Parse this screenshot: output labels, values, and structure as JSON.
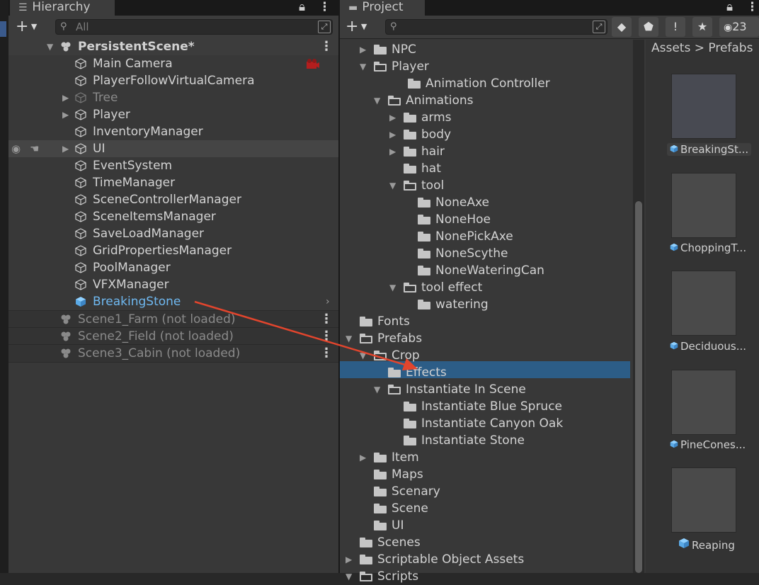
{
  "hierarchy": {
    "tab_title": "Hierarchy",
    "search_placeholder": "All",
    "scene_name": "PersistentScene*",
    "items": [
      {
        "label": "Main Camera"
      },
      {
        "label": "PlayerFollowVirtualCamera"
      },
      {
        "label": "Tree"
      },
      {
        "label": "Player"
      },
      {
        "label": "InventoryManager"
      },
      {
        "label": "UI"
      },
      {
        "label": "EventSystem"
      },
      {
        "label": "TimeManager"
      },
      {
        "label": "SceneControllerManager"
      },
      {
        "label": "SceneItemsManager"
      },
      {
        "label": "SaveLoadManager"
      },
      {
        "label": "GridPropertiesManager"
      },
      {
        "label": "PoolManager"
      },
      {
        "label": "VFXManager"
      },
      {
        "label": "BreakingStone"
      }
    ],
    "unloaded_scenes": [
      {
        "label": "Scene1_Farm (not loaded)"
      },
      {
        "label": "Scene2_Field (not loaded)"
      },
      {
        "label": "Scene3_Cabin (not loaded)"
      }
    ]
  },
  "project": {
    "tab_title": "Project",
    "hidden_count": "23",
    "breadcrumb": "Assets > Prefabs",
    "tree": [
      {
        "label": "NPC"
      },
      {
        "label": "Player"
      },
      {
        "label": "Animation Controller"
      },
      {
        "label": "Animations"
      },
      {
        "label": "arms"
      },
      {
        "label": "body"
      },
      {
        "label": "hair"
      },
      {
        "label": "hat"
      },
      {
        "label": "tool"
      },
      {
        "label": "NoneAxe"
      },
      {
        "label": "NoneHoe"
      },
      {
        "label": "NonePickAxe"
      },
      {
        "label": "NoneScythe"
      },
      {
        "label": "NoneWateringCan"
      },
      {
        "label": "tool effect"
      },
      {
        "label": "watering"
      },
      {
        "label": "Fonts"
      },
      {
        "label": "Prefabs"
      },
      {
        "label": "Crop"
      },
      {
        "label": "Effects"
      },
      {
        "label": "Instantiate In Scene"
      },
      {
        "label": "Instantiate Blue Spruce"
      },
      {
        "label": "Instantiate Canyon Oak"
      },
      {
        "label": "Instantiate Stone"
      },
      {
        "label": "Item"
      },
      {
        "label": "Maps"
      },
      {
        "label": "Scenary"
      },
      {
        "label": "Scene"
      },
      {
        "label": "UI"
      },
      {
        "label": "Scenes"
      },
      {
        "label": "Scriptable Object Assets"
      },
      {
        "label": "Scripts"
      }
    ],
    "assets": [
      {
        "label": "BreakingSt..."
      },
      {
        "label": "ChoppingT..."
      },
      {
        "label": "Deciduous..."
      },
      {
        "label": "PineCones..."
      },
      {
        "label": "Reaping"
      }
    ]
  },
  "colors": {
    "selection": "#2c5d87",
    "prefab_blue": "#5aa9e6",
    "annotation_arrow": "#e2452d"
  }
}
